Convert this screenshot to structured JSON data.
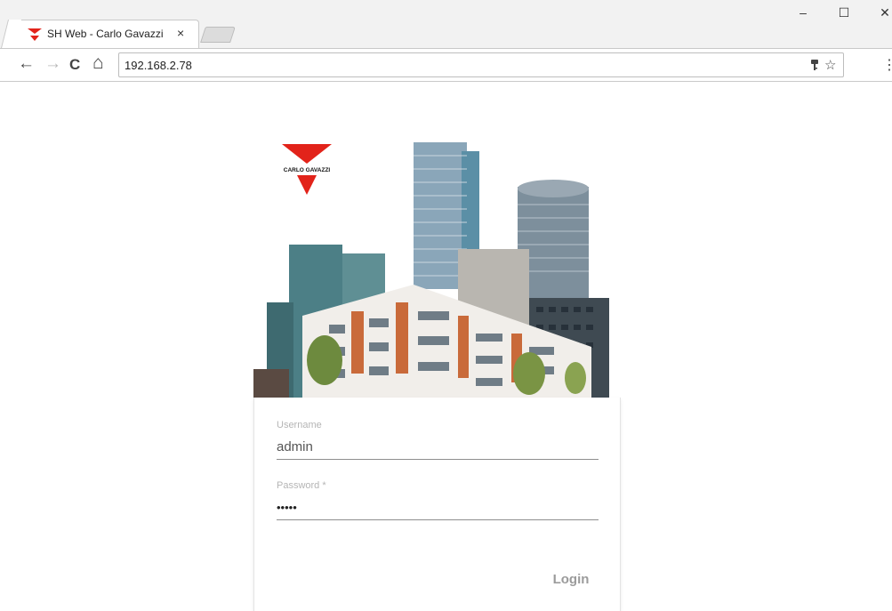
{
  "browser": {
    "tab_title": "SH Web - Carlo Gavazzi",
    "tab_close_glyph": "×",
    "url": "192.168.2.78",
    "window_controls": {
      "minimize": "–",
      "maximize": "☐",
      "close": "✕"
    },
    "nav": {
      "back": "←",
      "forward": "→",
      "reload": "C",
      "home": "⌂"
    },
    "omnibox_icons": {
      "key": "key-icon",
      "star": "☆"
    },
    "menu_glyph": "⋮"
  },
  "brand": {
    "logo_text": "CARLO GAVAZZI",
    "logo_color": "#e2231a"
  },
  "login": {
    "username_label": "Username",
    "username_value": "admin",
    "password_label": "Password *",
    "password_value": "•••••",
    "login_button": "Login"
  }
}
